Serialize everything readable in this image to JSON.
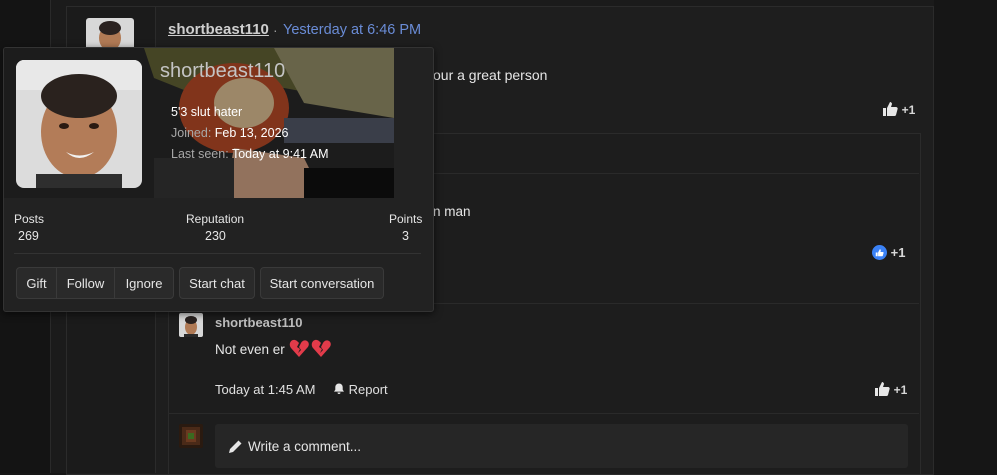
{
  "post": {
    "author": "shortbeast110",
    "separator": "·",
    "date": "Yesterday at 6:46 PM",
    "text_fragment": "our a great person",
    "like_count": "+1"
  },
  "comments": [
    {
      "text_fragment": "n man",
      "like_count": "+1"
    },
    {
      "author": "shortbeast110",
      "text": "Not even er",
      "emoji": "💔💔",
      "date": "Today at 1:45 AM",
      "report_label": "Report",
      "like_count": "+1"
    }
  ],
  "write_comment": {
    "label": "Write a comment..."
  },
  "popup": {
    "username": "shortbeast110",
    "custom_title": "5'3 slut hater",
    "joined_label": "Joined:",
    "joined_value": "Feb 13, 2026",
    "last_seen_label": "Last seen:",
    "last_seen_value": "Today at 9:41 AM",
    "stats": {
      "posts_label": "Posts",
      "posts_value": "269",
      "reputation_label": "Reputation",
      "reputation_value": "230",
      "points_label": "Points",
      "points_value": "3"
    },
    "buttons": {
      "gift": "Gift",
      "follow": "Follow",
      "ignore": "Ignore",
      "start_chat": "Start chat",
      "start_conversation": "Start conversation"
    }
  },
  "icons": {
    "like": "thumbs-up-icon",
    "report": "bell-icon",
    "write": "pencil-icon"
  },
  "colors": {
    "link_blue": "#6a8cd6",
    "like_blue": "#3b82f6",
    "heart_red": "#e23b4a"
  }
}
